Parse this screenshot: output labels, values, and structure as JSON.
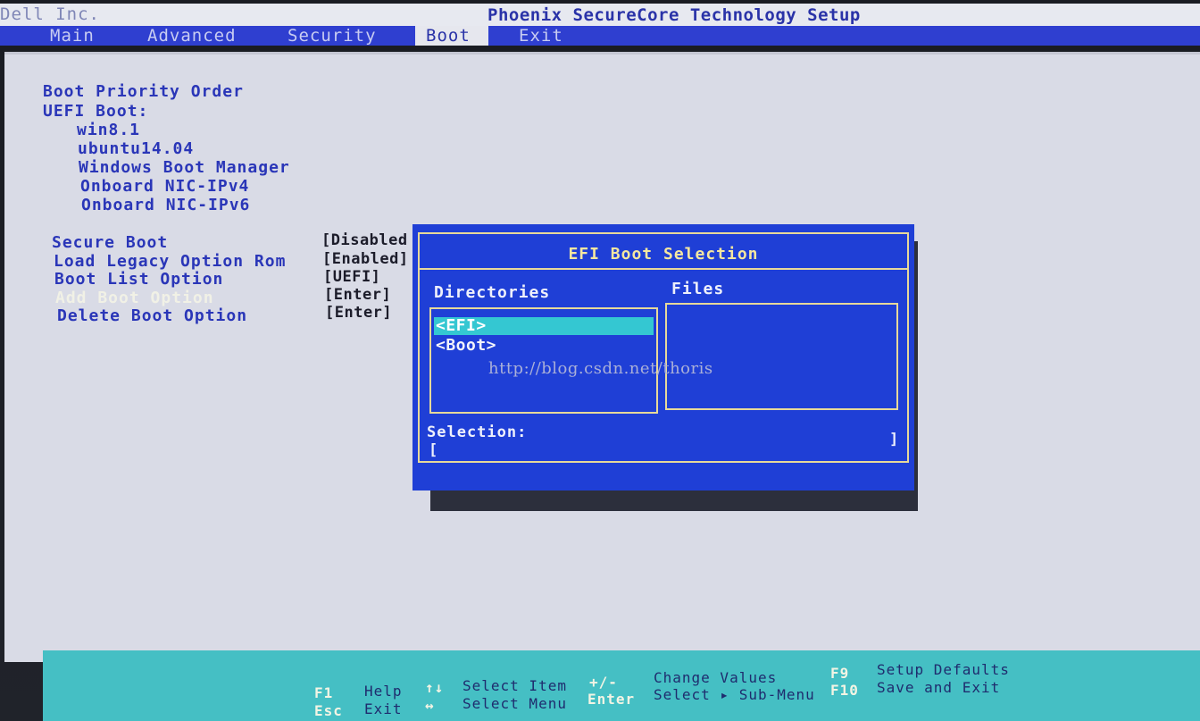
{
  "titlebar": {
    "vendor": "Dell Inc.",
    "product": "Phoenix SecureCore Technology Setup"
  },
  "menu": {
    "tabs": [
      "Main",
      "Advanced",
      "Security",
      "Boot",
      "Exit"
    ],
    "active": "Boot"
  },
  "boot_priority": {
    "heading": "Boot Priority Order",
    "uefi_label": "UEFI Boot:",
    "entries": [
      "win8.1",
      "ubuntu14.04",
      "Windows Boot Manager",
      "Onboard NIC-IPv4",
      "Onboard NIC-IPv6"
    ]
  },
  "settings": [
    {
      "label": "Secure Boot",
      "value": "[Disabled"
    },
    {
      "label": "Load Legacy Option Rom",
      "value": "[Enabled]"
    },
    {
      "label": "Boot List Option",
      "value": "[UEFI]"
    },
    {
      "label": "Add Boot Option",
      "value": "Enter",
      "value_open": "[",
      "value_close": "]"
    },
    {
      "label": "Delete Boot Option",
      "value": "[Enter]"
    }
  ],
  "dialog": {
    "title": "EFI Boot Selection",
    "directories_label": "Directories",
    "files_label": "Files",
    "directories": [
      "<EFI>",
      "<Boot>"
    ],
    "selected_directory": "<EFI>",
    "selection_label": "Selection:",
    "selection_open": "[",
    "selection_close": "]"
  },
  "watermark": "http://blog.csdn.net/thoris",
  "footer": {
    "row1": [
      {
        "key": "F1",
        "desc": "Help"
      },
      {
        "key": "↑↓",
        "desc": "Select Item"
      },
      {
        "key": "+/-",
        "desc": "Change Values"
      },
      {
        "key": "F9",
        "desc": "Setup Defaults"
      }
    ],
    "row2": [
      {
        "key": "Esc",
        "desc": "Exit"
      },
      {
        "key": "↔",
        "desc": "Select Menu"
      },
      {
        "key": "Enter",
        "desc": "Select ▸ Sub-Menu"
      },
      {
        "key": "F10",
        "desc": "Save and Exit"
      }
    ]
  },
  "colors": {
    "menubar": "#2f3fd0",
    "panel": "#d9dbe6",
    "dialog": "#1f3fd6",
    "footer": "#45bfc4",
    "highlight": "#34c7d2"
  }
}
